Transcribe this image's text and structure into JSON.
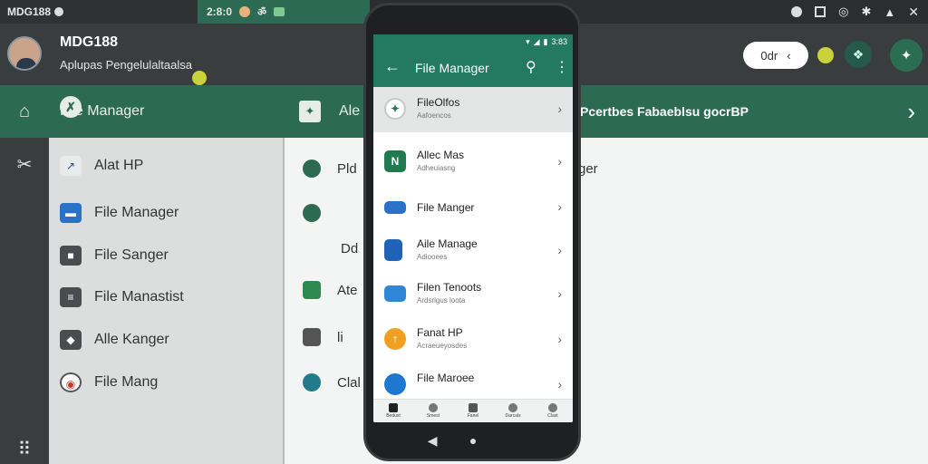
{
  "topbar": {
    "left_text": "MDG188",
    "mid_text": "2:8:0",
    "mid_icons": [
      "record-icon",
      "mute-icon",
      "chat-icon"
    ],
    "right_icons": [
      "clock-icon",
      "box-icon",
      "wifi-icon",
      "settings-icon",
      "battery-icon",
      "close-icon"
    ]
  },
  "header": {
    "title": "MDG188",
    "subtitle": "Aplupas Pengelulaltaalsa",
    "pill_text": "0dr",
    "pill_chevron": "‹",
    "circle1_icon": "leaf-icon",
    "circle2_icon": "share-icon"
  },
  "rail": {
    "items": [
      {
        "name": "home-icon",
        "glyph": "⌂"
      },
      {
        "name": "tools-icon",
        "glyph": "✂"
      },
      {
        "name": "grid-icon",
        "glyph": "⠿"
      }
    ]
  },
  "panel1": {
    "header_label": "File Manager",
    "items": [
      {
        "label": "Alat HP",
        "icon": "send-icon",
        "glyph": "↗"
      },
      {
        "label": "File Manager",
        "icon": "folder-icon",
        "glyph": "▬"
      },
      {
        "label": "File Sanger",
        "icon": "file-icon",
        "glyph": "■"
      },
      {
        "label": "File Manastist",
        "icon": "list-icon",
        "glyph": "≡"
      },
      {
        "label": "Alle Kanger",
        "icon": "diamond-icon",
        "glyph": "◆"
      },
      {
        "label": "File Mang",
        "icon": "disc-icon",
        "glyph": "◉"
      }
    ]
  },
  "panel2": {
    "header_label": "Ale",
    "banner": "Pcertbes Fabaeblsu gocrBP",
    "right_text": "ger",
    "items": [
      {
        "label": "Pld",
        "icon": "cloud-icon"
      },
      {
        "label": "",
        "icon": "cloud-icon"
      },
      {
        "label": "Dd",
        "icon": "none"
      },
      {
        "label": "Ate",
        "icon": "folder-icon"
      },
      {
        "label": "li",
        "icon": "book-icon"
      },
      {
        "label": "Clal",
        "icon": "cloud-icon"
      }
    ]
  },
  "phone": {
    "status_time": "3:83",
    "appbar_title": "File Manager",
    "items": [
      {
        "name": "FileOlfos",
        "desc": "Aafoencos",
        "color": "#237a5e",
        "shape": "circle-outline",
        "selected": true
      },
      {
        "name": "Allec Mas",
        "desc": "Adheuiasng",
        "color": "#1f7a4f",
        "shape": "square",
        "selected": false
      },
      {
        "name": "File Manger",
        "desc": "",
        "color": "#2a72c8",
        "shape": "square",
        "selected": false
      },
      {
        "name": "Aile Manage",
        "desc": "Adiooees",
        "color": "#1e63b5",
        "shape": "square",
        "selected": false
      },
      {
        "name": "Filen Tenoots",
        "desc": "Ardsrlgus loota",
        "color": "#2f86d6",
        "shape": "square",
        "selected": false
      },
      {
        "name": "Fanat HP",
        "desc": "Acraeueyosdes",
        "color": "#f0a020",
        "shape": "circle",
        "selected": false
      },
      {
        "name": "File Maroee",
        "desc": "",
        "color": "#1e78d0",
        "shape": "circle",
        "selected": false
      }
    ],
    "bottom_nav": [
      "Bedust",
      "Smest",
      "Fanel",
      "Darcals",
      "Clast"
    ],
    "nav_keys": [
      "◀",
      "●",
      "■"
    ]
  }
}
